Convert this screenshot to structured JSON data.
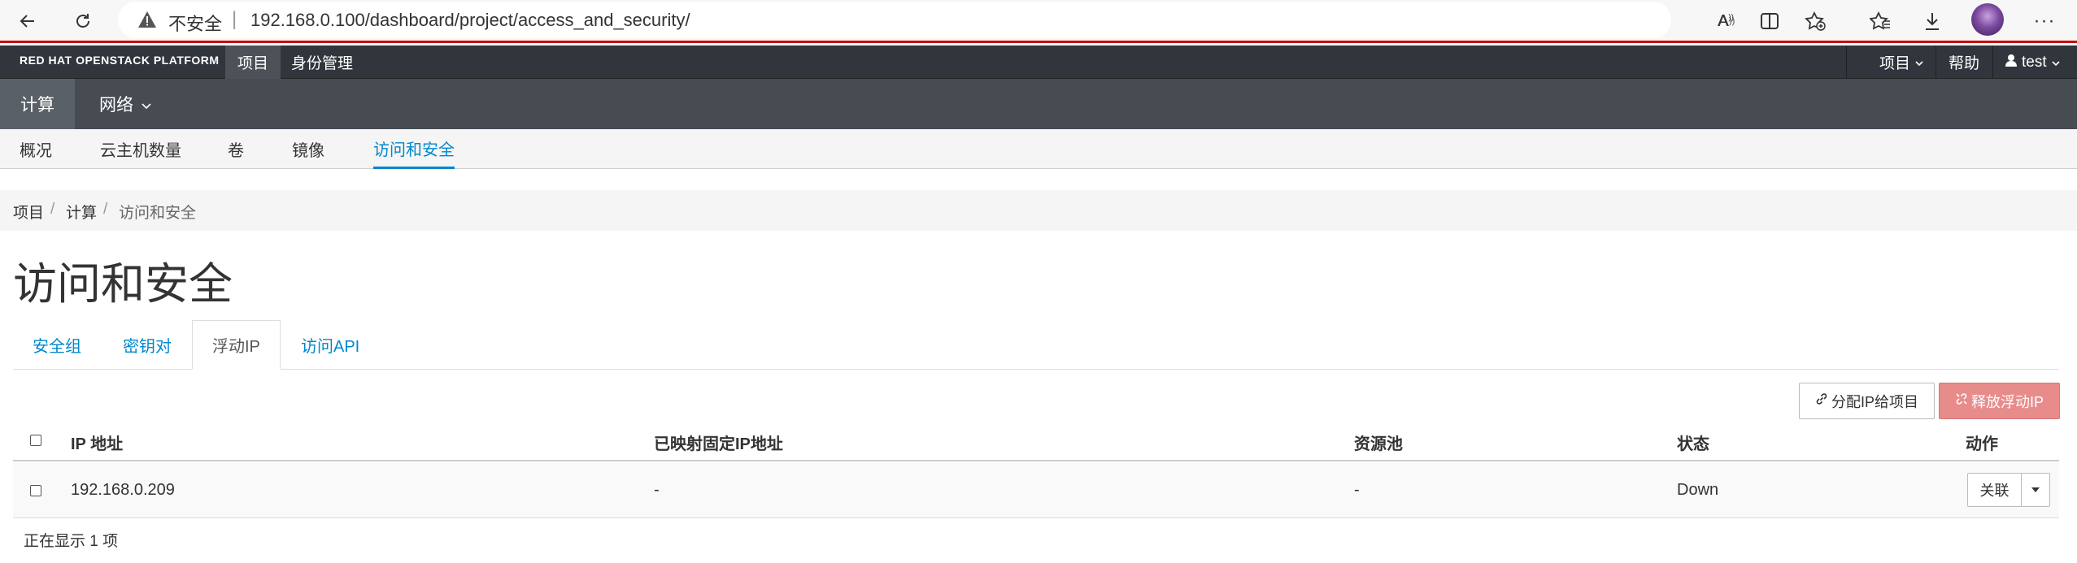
{
  "browser": {
    "insecure_label": "不安全",
    "separator": "|",
    "url": "192.168.0.100/dashboard/project/access_and_security/",
    "icons": [
      "back-icon",
      "refresh-icon",
      "warning-icon",
      "read-aloud-icon",
      "split-screen-icon",
      "add-favorite-icon",
      "favorites-icon",
      "download-icon",
      "profile-avatar",
      "more-icon"
    ]
  },
  "topnav": {
    "brand": "RED HAT OPENSTACK PLATFORM",
    "project": "项目",
    "identity": "身份管理",
    "right_project": "项目",
    "help": "帮助",
    "user": "test"
  },
  "secondnav": {
    "compute": "计算",
    "network": "网络"
  },
  "thirdnav": {
    "items": [
      "概况",
      "云主机数量",
      "卷",
      "镜像",
      "访问和安全"
    ]
  },
  "breadcrumb": {
    "items": [
      "项目",
      "计算",
      "访问和安全"
    ],
    "separator": "/"
  },
  "page": {
    "title": "访问和安全"
  },
  "tabs": [
    "安全组",
    "密钥对",
    "浮动IP",
    "访问API"
  ],
  "actions": {
    "allocate": "分配IP给项目",
    "release": "释放浮动IP"
  },
  "table": {
    "columns": [
      "IP 地址",
      "已映射固定IP地址",
      "资源池",
      "状态",
      "动作"
    ],
    "rows": [
      {
        "ip": "192.168.0.209",
        "fixed_ip": "-",
        "pool": "-",
        "status": "Down",
        "action": "关联"
      }
    ],
    "footer": "正在显示 1 项"
  },
  "colors": {
    "accent": "#0088ce",
    "danger": "#e88b8b",
    "header_dark": "#30363c",
    "header_mid": "#464c52",
    "browser_accent": "#cc0000"
  }
}
